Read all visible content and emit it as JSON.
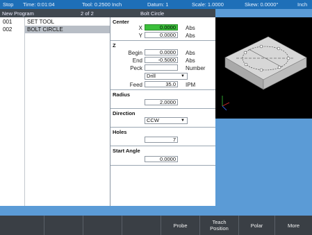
{
  "status": {
    "mode": "Stop",
    "time": "Time: 0:01:04",
    "tool": "Tool: 0.2500 Inch",
    "datum": "Datum: 1",
    "scale": "Scale: 1.0000",
    "skew": "Skew: 0.0000°",
    "units": "Inch"
  },
  "titlebar": {
    "program": "New Program",
    "position": "2 of 2",
    "feature": "Bolt Circle"
  },
  "program": {
    "rows": [
      {
        "num": "001",
        "name": "SET TOOL"
      },
      {
        "num": "002",
        "name": "BOLT CIRCLE"
      }
    ]
  },
  "form": {
    "center": {
      "title": "Center",
      "x_label": "X",
      "x_value": "0.0000",
      "x_unit": "Abs",
      "y_label": "Y",
      "y_value": "0.0000",
      "y_unit": "Abs"
    },
    "z": {
      "title": "Z",
      "begin_label": "Begin",
      "begin_value": "0.0000",
      "begin_unit": "Abs",
      "end_label": "End",
      "end_value": "-0.5000",
      "end_unit": "Abs",
      "peck_label": "Peck",
      "peck_unit": "Number",
      "cycle_value": "Drill",
      "feed_label": "Feed",
      "feed_value": "35.0",
      "feed_unit": "IPM"
    },
    "radius": {
      "title": "Radius",
      "value": "2.0000"
    },
    "direction": {
      "title": "Direction",
      "value": "CCW"
    },
    "holes": {
      "title": "Holes",
      "value": "7"
    },
    "start_angle": {
      "title": "Start Angle",
      "value": "0.0000"
    }
  },
  "softkeys": [
    "",
    "",
    "",
    "",
    "Probe",
    "Teach\nPosition",
    "Polar",
    "More"
  ],
  "colors": {
    "status_bar": "#1e6fb8",
    "background": "#5b9bd6",
    "active_field": "#3bbf3b",
    "softkey_bar": "#3a3f45"
  }
}
